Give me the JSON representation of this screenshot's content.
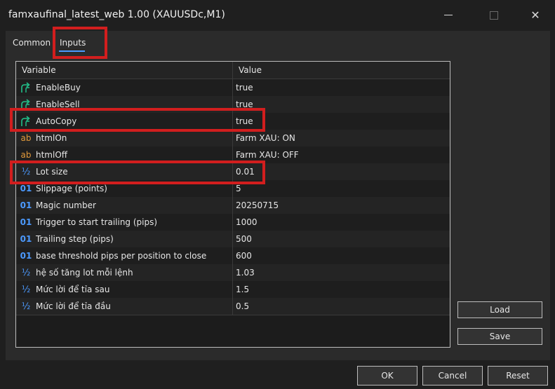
{
  "window": {
    "title": "famxaufinal_latest_web 1.00 (XAUUSDc,M1)",
    "controls": {
      "minimize": "–",
      "maximize": "□",
      "close": "✕"
    }
  },
  "tabs": {
    "common": "Common",
    "inputs": "Inputs"
  },
  "table": {
    "headers": {
      "variable": "Variable",
      "value": "Value"
    },
    "rows": [
      {
        "icon": "bool",
        "variable": "EnableBuy",
        "value": "true"
      },
      {
        "icon": "bool",
        "variable": "EnableSell",
        "value": "true"
      },
      {
        "icon": "bool",
        "variable": "AutoCopy",
        "value": "true"
      },
      {
        "icon": "text",
        "icon_text": "ab",
        "variable": "htmlOn",
        "value": "Farm XAU: ON"
      },
      {
        "icon": "text",
        "icon_text": "ab",
        "variable": "htmlOff",
        "value": "Farm XAU: OFF"
      },
      {
        "icon": "frac",
        "icon_text": "½",
        "variable": "Lot size",
        "value": "0.01"
      },
      {
        "icon": "num",
        "icon_text": "01",
        "variable": "Slippage (points)",
        "value": "5"
      },
      {
        "icon": "num",
        "icon_text": "01",
        "variable": "Magic number",
        "value": "20250715"
      },
      {
        "icon": "num",
        "icon_text": "01",
        "variable": "Trigger to start trailing (pips)",
        "value": "1000"
      },
      {
        "icon": "num",
        "icon_text": "01",
        "variable": "Trailing step (pips)",
        "value": "500"
      },
      {
        "icon": "num",
        "icon_text": "01",
        "variable": "base threshold pips per position to close",
        "value": "600"
      },
      {
        "icon": "frac",
        "icon_text": "½",
        "variable": "hệ số tăng lot mỗi lệnh",
        "value": "1.03"
      },
      {
        "icon": "frac",
        "icon_text": "½",
        "variable": "Mức lời để tỉa sau",
        "value": "1.5"
      },
      {
        "icon": "frac",
        "icon_text": "½",
        "variable": "Mức lời để tỉa đầu",
        "value": "0.5"
      }
    ]
  },
  "buttons": {
    "load": "Load",
    "save": "Save",
    "ok": "OK",
    "cancel": "Cancel",
    "reset": "Reset"
  },
  "colors": {
    "highlight": "#d21e1e",
    "accent": "#4c9aff",
    "bool_icon": "#22c08a",
    "text_icon": "#e19a3b"
  }
}
